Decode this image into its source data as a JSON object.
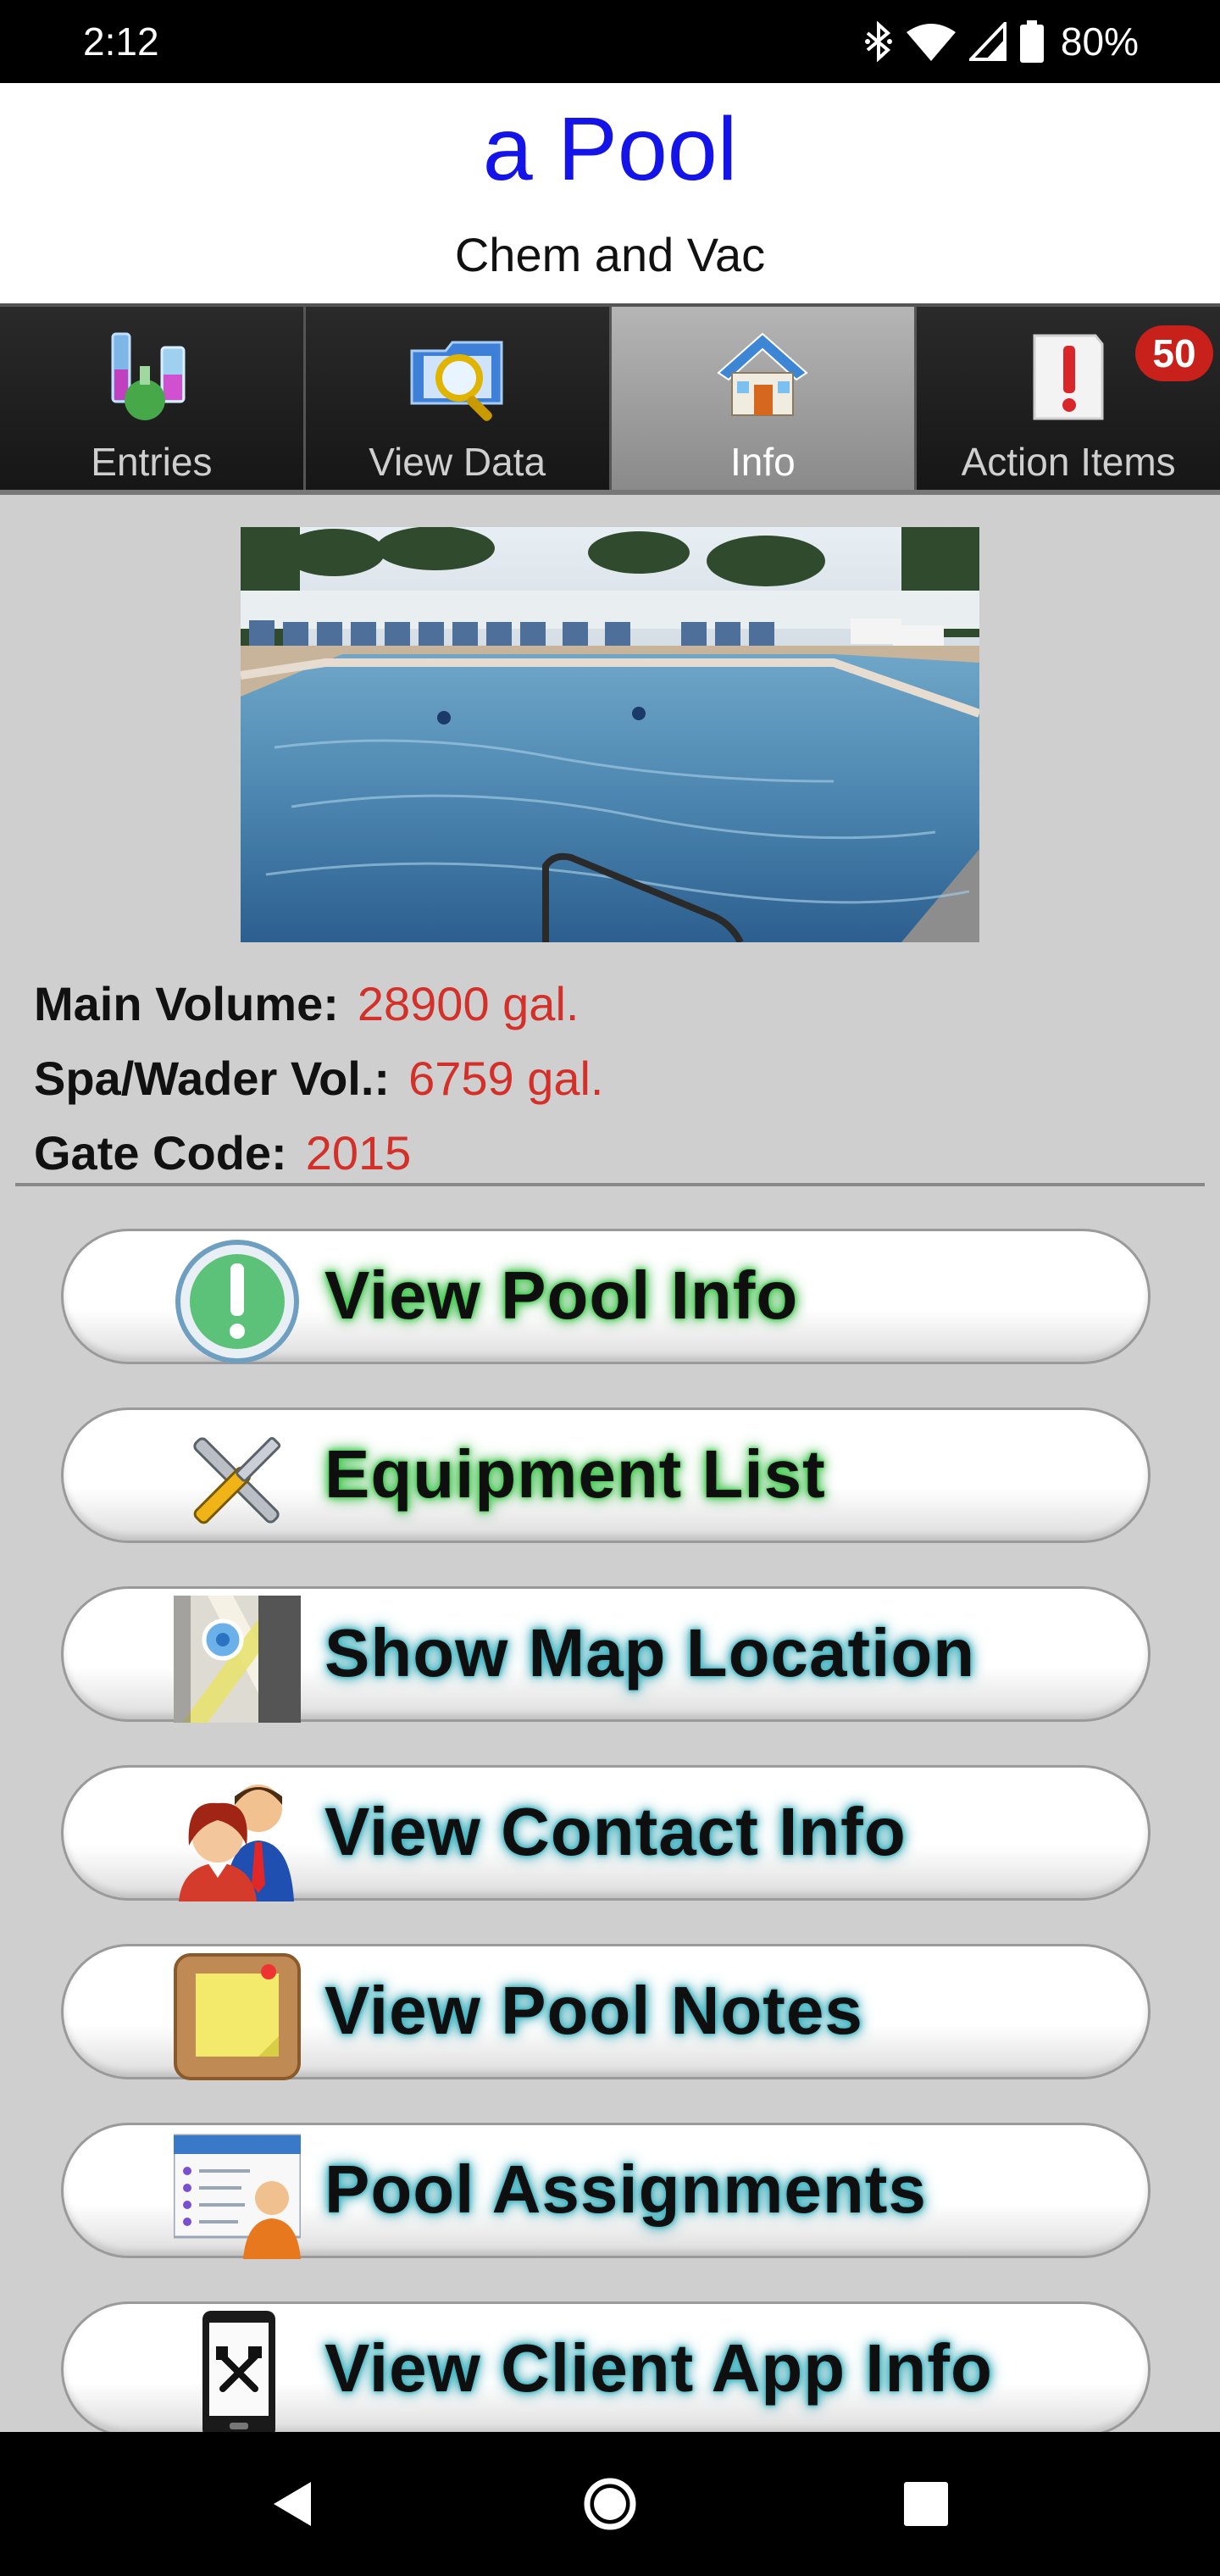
{
  "status_bar": {
    "time": "2:12",
    "battery": "80%",
    "icons": [
      "bluetooth-icon",
      "wifi-icon",
      "signal-icon",
      "battery-icon"
    ]
  },
  "header": {
    "title": "a Pool",
    "subtitle": "Chem and Vac"
  },
  "tabs": [
    {
      "label": "Entries",
      "icon": "flasks-icon",
      "active": false
    },
    {
      "label": "View Data",
      "icon": "search-folder-icon",
      "active": false
    },
    {
      "label": "Info",
      "icon": "house-icon",
      "active": true
    },
    {
      "label": "Action Items",
      "icon": "alert-document-icon",
      "active": false,
      "badge": "50"
    }
  ],
  "pool_info": {
    "main_volume": {
      "label": "Main Volume:",
      "value": "28900 gal."
    },
    "spa_volume": {
      "label": "Spa/Wader Vol.:",
      "value": "6759 gal."
    },
    "gate_code": {
      "label": "Gate Code:",
      "value": "2015"
    }
  },
  "buttons": [
    {
      "label": "View Pool Info",
      "icon": "info-exclamation-icon"
    },
    {
      "label": "Equipment List",
      "icon": "tools-icon"
    },
    {
      "label": "Show Map Location",
      "icon": "map-pin-icon"
    },
    {
      "label": "View Contact Info",
      "icon": "contacts-icon"
    },
    {
      "label": "View Pool Notes",
      "icon": "sticky-note-icon"
    },
    {
      "label": "Pool Assignments",
      "icon": "assignment-list-icon"
    },
    {
      "label": "View Client App Info",
      "icon": "phone-tools-icon"
    }
  ],
  "colors": {
    "title": "#1414e8",
    "value": "#d3302a",
    "badge": "#c8201a",
    "glow_green": "#3bd14a",
    "glow_teal": "#36b6c4"
  }
}
